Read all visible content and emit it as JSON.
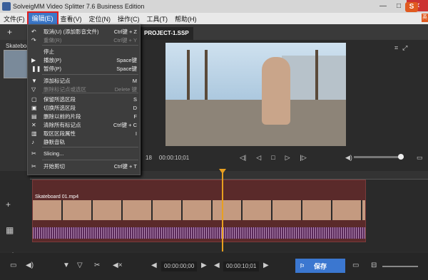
{
  "window": {
    "title": "SolveigMM Video Splitter 7.6 Business Edition",
    "minimize": "—",
    "maximize": "□",
    "close": "✕"
  },
  "menubar": {
    "items": [
      "文件(F)",
      "编辑(E)",
      "查看(V)",
      "定位(N)",
      "操作(C)",
      "工具(T)",
      "帮助(H)"
    ]
  },
  "brand": {
    "logo": "S",
    "side": "英"
  },
  "project_tab": "PROJECT-1.SSP",
  "left_panel": {
    "label": "Skateboa"
  },
  "edit_menu": [
    {
      "icon": "undo-icon",
      "glyph": "↶",
      "label": "取消(U) (添加影音文件)",
      "shortcut": "Ctrl键 + Z",
      "disabled": false
    },
    {
      "icon": "redo-icon",
      "glyph": "↷",
      "label": "重做(R)",
      "shortcut": "Ctrl键 + Y",
      "disabled": true
    },
    {
      "icon": "",
      "glyph": "",
      "label": "停止",
      "shortcut": "",
      "disabled": false
    },
    {
      "icon": "play-icon",
      "glyph": "▶",
      "label": "播放(P)",
      "shortcut": "Space键",
      "disabled": false
    },
    {
      "icon": "pause-icon",
      "glyph": "❚❚",
      "label": "暂停(P)",
      "shortcut": "Space键",
      "disabled": false
    },
    {
      "icon": "add-marker-icon",
      "glyph": "▼",
      "label": "添加标记点",
      "shortcut": "M",
      "disabled": false
    },
    {
      "icon": "delete-marker-icon",
      "glyph": "▽",
      "label": "删除标记点或选区",
      "shortcut": "Delete 键",
      "disabled": true
    },
    {
      "icon": "keep-segment-icon",
      "glyph": "▢",
      "label": "保留所选区段",
      "shortcut": "S",
      "disabled": false
    },
    {
      "icon": "toggle-segment-icon",
      "glyph": "▣",
      "label": "切换所选区段",
      "shortcut": "D",
      "disabled": false
    },
    {
      "icon": "delete-segment-icon",
      "glyph": "▤",
      "label": "删除以前的片段",
      "shortcut": "F",
      "disabled": false
    },
    {
      "icon": "clear-markers-icon",
      "glyph": "✕",
      "label": "清除所有标记点",
      "shortcut": "Ctrl键 + C",
      "disabled": false
    },
    {
      "icon": "segment-props-icon",
      "glyph": "▥",
      "label": "取区区段属性",
      "shortcut": "I",
      "disabled": false
    },
    {
      "icon": "mute-icon",
      "glyph": "♪",
      "label": "静默音轨",
      "shortcut": "",
      "disabled": false
    },
    {
      "icon": "slicing-icon",
      "glyph": "✂",
      "label": "Slicing...",
      "shortcut": "",
      "disabled": false
    },
    {
      "icon": "start-cut-icon",
      "glyph": "✂",
      "label": "开始剪切",
      "shortcut": "Ctrl键 + T",
      "disabled": false
    }
  ],
  "player": {
    "time_left": "18",
    "time": "00:00:10;01"
  },
  "clip": {
    "label": "Skateboard 01.mp4"
  },
  "bottombar": {
    "time_start": "00:00:00;00",
    "time_end": "00:00:10;01",
    "save_label": "保存",
    "flag": "⚐"
  }
}
